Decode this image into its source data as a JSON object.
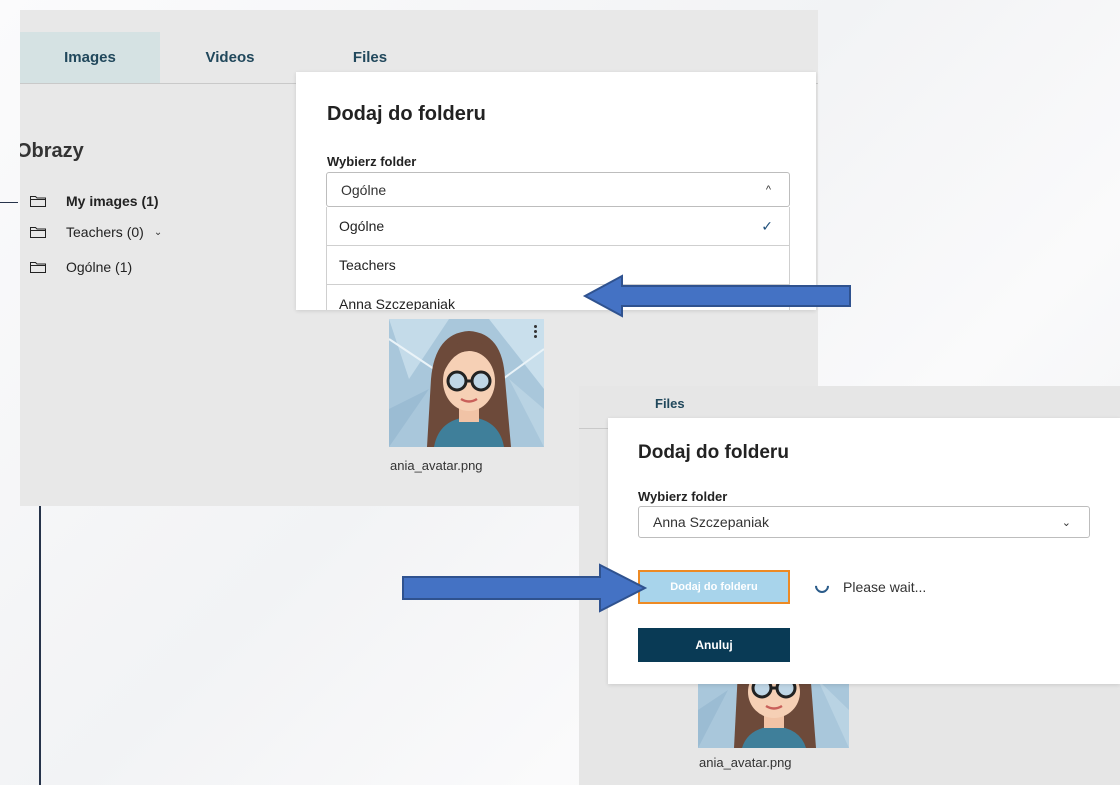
{
  "panel1": {
    "tabs": [
      {
        "label": "Images",
        "active": true
      },
      {
        "label": "Videos",
        "active": false
      },
      {
        "label": "Files",
        "active": false
      }
    ],
    "section_title": "Obrazy",
    "folders": [
      {
        "label": "My images (1)",
        "bold": true
      },
      {
        "label": "Teachers (0)",
        "expandable": true
      },
      {
        "label": "Ogólne (1)"
      }
    ],
    "thumbnail_label": "ania_avatar.png",
    "dialog": {
      "title": "Dodaj do folderu",
      "field_label": "Wybierz folder",
      "selected_value": "Ogólne",
      "caret": "^",
      "options": [
        {
          "label": "Ogólne",
          "checked": true
        },
        {
          "label": "Teachers",
          "checked": false
        },
        {
          "label": "Anna Szczepaniak",
          "checked": false
        }
      ],
      "check_icon": "✓"
    }
  },
  "panel2": {
    "tab_label": "Files",
    "dialog": {
      "title": "Dodaj do folderu",
      "field_label": "Wybierz folder",
      "selected_value": "Anna Szczepaniak",
      "caret": "⌄",
      "submit_label": "Dodaj do folderu",
      "loading_text": "Please wait...",
      "cancel_label": "Anuluj"
    },
    "thumbnail_label": "ania_avatar.png"
  },
  "colors": {
    "arrow_fill": "#4472c4",
    "arrow_stroke": "#2f528f",
    "tab_active_bg": "#d5e2e3",
    "tab_text": "#21485c",
    "primary_button_bg": "#a8d4eb",
    "primary_button_border": "#ed8a24",
    "cancel_button_bg": "#093a55"
  },
  "icons": [
    "folder-icon",
    "chevron-down-icon",
    "caret-up-icon",
    "check-icon",
    "kebab-menu-icon",
    "spinner-icon",
    "arrow-left-annotation",
    "arrow-right-annotation"
  ]
}
